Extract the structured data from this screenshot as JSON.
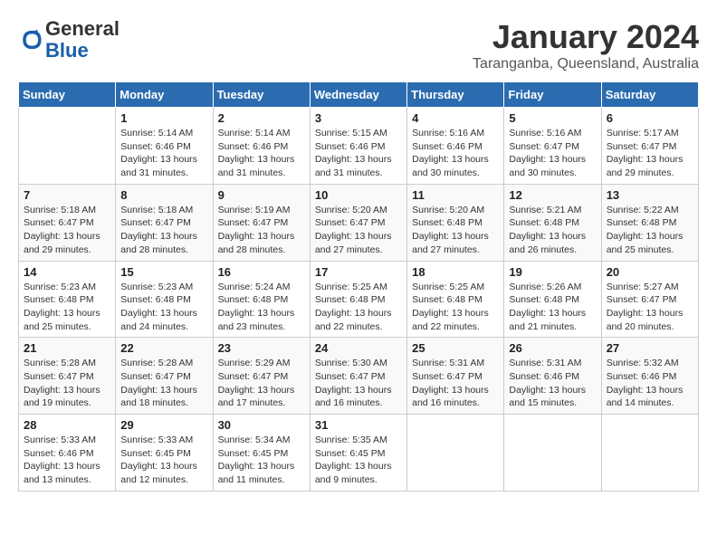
{
  "header": {
    "logo_line1": "General",
    "logo_line2": "Blue",
    "month": "January 2024",
    "location": "Taranganba, Queensland, Australia"
  },
  "weekdays": [
    "Sunday",
    "Monday",
    "Tuesday",
    "Wednesday",
    "Thursday",
    "Friday",
    "Saturday"
  ],
  "weeks": [
    [
      {
        "day": "",
        "sunrise": "",
        "sunset": "",
        "daylight": ""
      },
      {
        "day": "1",
        "sunrise": "5:14 AM",
        "sunset": "6:46 PM",
        "daylight": "13 hours and 31 minutes."
      },
      {
        "day": "2",
        "sunrise": "5:14 AM",
        "sunset": "6:46 PM",
        "daylight": "13 hours and 31 minutes."
      },
      {
        "day": "3",
        "sunrise": "5:15 AM",
        "sunset": "6:46 PM",
        "daylight": "13 hours and 31 minutes."
      },
      {
        "day": "4",
        "sunrise": "5:16 AM",
        "sunset": "6:46 PM",
        "daylight": "13 hours and 30 minutes."
      },
      {
        "day": "5",
        "sunrise": "5:16 AM",
        "sunset": "6:47 PM",
        "daylight": "13 hours and 30 minutes."
      },
      {
        "day": "6",
        "sunrise": "5:17 AM",
        "sunset": "6:47 PM",
        "daylight": "13 hours and 29 minutes."
      }
    ],
    [
      {
        "day": "7",
        "sunrise": "5:18 AM",
        "sunset": "6:47 PM",
        "daylight": "13 hours and 29 minutes."
      },
      {
        "day": "8",
        "sunrise": "5:18 AM",
        "sunset": "6:47 PM",
        "daylight": "13 hours and 28 minutes."
      },
      {
        "day": "9",
        "sunrise": "5:19 AM",
        "sunset": "6:47 PM",
        "daylight": "13 hours and 28 minutes."
      },
      {
        "day": "10",
        "sunrise": "5:20 AM",
        "sunset": "6:47 PM",
        "daylight": "13 hours and 27 minutes."
      },
      {
        "day": "11",
        "sunrise": "5:20 AM",
        "sunset": "6:48 PM",
        "daylight": "13 hours and 27 minutes."
      },
      {
        "day": "12",
        "sunrise": "5:21 AM",
        "sunset": "6:48 PM",
        "daylight": "13 hours and 26 minutes."
      },
      {
        "day": "13",
        "sunrise": "5:22 AM",
        "sunset": "6:48 PM",
        "daylight": "13 hours and 25 minutes."
      }
    ],
    [
      {
        "day": "14",
        "sunrise": "5:23 AM",
        "sunset": "6:48 PM",
        "daylight": "13 hours and 25 minutes."
      },
      {
        "day": "15",
        "sunrise": "5:23 AM",
        "sunset": "6:48 PM",
        "daylight": "13 hours and 24 minutes."
      },
      {
        "day": "16",
        "sunrise": "5:24 AM",
        "sunset": "6:48 PM",
        "daylight": "13 hours and 23 minutes."
      },
      {
        "day": "17",
        "sunrise": "5:25 AM",
        "sunset": "6:48 PM",
        "daylight": "13 hours and 22 minutes."
      },
      {
        "day": "18",
        "sunrise": "5:25 AM",
        "sunset": "6:48 PM",
        "daylight": "13 hours and 22 minutes."
      },
      {
        "day": "19",
        "sunrise": "5:26 AM",
        "sunset": "6:48 PM",
        "daylight": "13 hours and 21 minutes."
      },
      {
        "day": "20",
        "sunrise": "5:27 AM",
        "sunset": "6:47 PM",
        "daylight": "13 hours and 20 minutes."
      }
    ],
    [
      {
        "day": "21",
        "sunrise": "5:28 AM",
        "sunset": "6:47 PM",
        "daylight": "13 hours and 19 minutes."
      },
      {
        "day": "22",
        "sunrise": "5:28 AM",
        "sunset": "6:47 PM",
        "daylight": "13 hours and 18 minutes."
      },
      {
        "day": "23",
        "sunrise": "5:29 AM",
        "sunset": "6:47 PM",
        "daylight": "13 hours and 17 minutes."
      },
      {
        "day": "24",
        "sunrise": "5:30 AM",
        "sunset": "6:47 PM",
        "daylight": "13 hours and 16 minutes."
      },
      {
        "day": "25",
        "sunrise": "5:31 AM",
        "sunset": "6:47 PM",
        "daylight": "13 hours and 16 minutes."
      },
      {
        "day": "26",
        "sunrise": "5:31 AM",
        "sunset": "6:46 PM",
        "daylight": "13 hours and 15 minutes."
      },
      {
        "day": "27",
        "sunrise": "5:32 AM",
        "sunset": "6:46 PM",
        "daylight": "13 hours and 14 minutes."
      }
    ],
    [
      {
        "day": "28",
        "sunrise": "5:33 AM",
        "sunset": "6:46 PM",
        "daylight": "13 hours and 13 minutes."
      },
      {
        "day": "29",
        "sunrise": "5:33 AM",
        "sunset": "6:45 PM",
        "daylight": "13 hours and 12 minutes."
      },
      {
        "day": "30",
        "sunrise": "5:34 AM",
        "sunset": "6:45 PM",
        "daylight": "13 hours and 11 minutes."
      },
      {
        "day": "31",
        "sunrise": "5:35 AM",
        "sunset": "6:45 PM",
        "daylight": "13 hours and 9 minutes."
      },
      {
        "day": "",
        "sunrise": "",
        "sunset": "",
        "daylight": ""
      },
      {
        "day": "",
        "sunrise": "",
        "sunset": "",
        "daylight": ""
      },
      {
        "day": "",
        "sunrise": "",
        "sunset": "",
        "daylight": ""
      }
    ]
  ]
}
